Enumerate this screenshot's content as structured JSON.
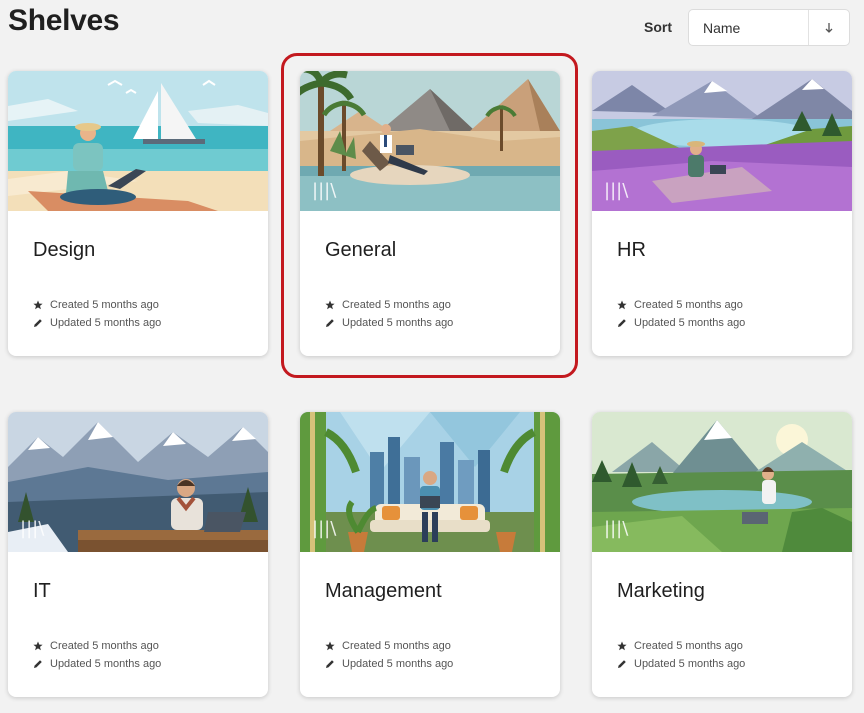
{
  "header": {
    "title": "Shelves",
    "sort_label": "Sort",
    "sort_value": "Name",
    "sort_direction": "↓"
  },
  "shelves": [
    {
      "name": "Design",
      "created": "Created 5 months ago",
      "updated": "Updated 5 months ago"
    },
    {
      "name": "General",
      "created": "Created 5 months ago",
      "updated": "Updated 5 months ago"
    },
    {
      "name": "HR",
      "created": "Created 5 months ago",
      "updated": "Updated 5 months ago"
    },
    {
      "name": "IT",
      "created": "Created 5 months ago",
      "updated": "Updated 5 months ago"
    },
    {
      "name": "Management",
      "created": "Created 5 months ago",
      "updated": "Updated 5 months ago"
    },
    {
      "name": "Marketing",
      "created": "Created 5 months ago",
      "updated": "Updated 5 months ago"
    }
  ],
  "colors": {
    "highlight": "#c3191f",
    "page_background": "#f2f2f2"
  },
  "icons": {
    "created": "star-icon",
    "updated": "pencil-icon",
    "sort": "arrow-down-icon"
  }
}
